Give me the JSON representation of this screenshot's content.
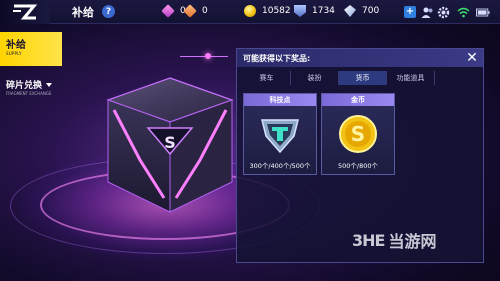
{
  "app": {
    "title": "补给",
    "help_symbol": "?"
  },
  "resources": {
    "gem_pink": {
      "icon": "pink-gem-icon",
      "value": "0"
    },
    "gem_orange": {
      "icon": "orange-gem-icon",
      "value": "0"
    },
    "coins": {
      "icon": "coin-icon",
      "value": "10582"
    },
    "tech_points": {
      "icon": "shield-icon",
      "value": "1734"
    },
    "diamonds": {
      "icon": "diamond-icon",
      "value": "700"
    }
  },
  "topbar": {
    "add_symbol": "+"
  },
  "sidebar": {
    "items": [
      {
        "label": "补给",
        "sub": "SUPPLY",
        "active": true
      },
      {
        "label": "碎片兑换",
        "sub": "FRAGMENT EXCHANGE",
        "active": false
      }
    ]
  },
  "panel": {
    "title": "可能获得以下奖品:",
    "close_symbol": "✕",
    "tabs": [
      {
        "label": "赛车",
        "active": false
      },
      {
        "label": "装扮",
        "active": false
      },
      {
        "label": "货币",
        "active": true
      },
      {
        "label": "功能道具",
        "active": false
      }
    ],
    "rewards": [
      {
        "title": "科技点",
        "value": "300个/400个/500个",
        "icon": "tech-point-icon"
      },
      {
        "title": "金币",
        "value": "500个/800个",
        "icon": "gold-coin-icon"
      }
    ]
  },
  "box": {
    "letter": "S"
  },
  "watermark": {
    "logo": "3HE",
    "text": "当游网"
  },
  "colors": {
    "accent_yellow": "#ffd400",
    "panel_bg": "#141234",
    "coin_gold": "#f2c214"
  }
}
